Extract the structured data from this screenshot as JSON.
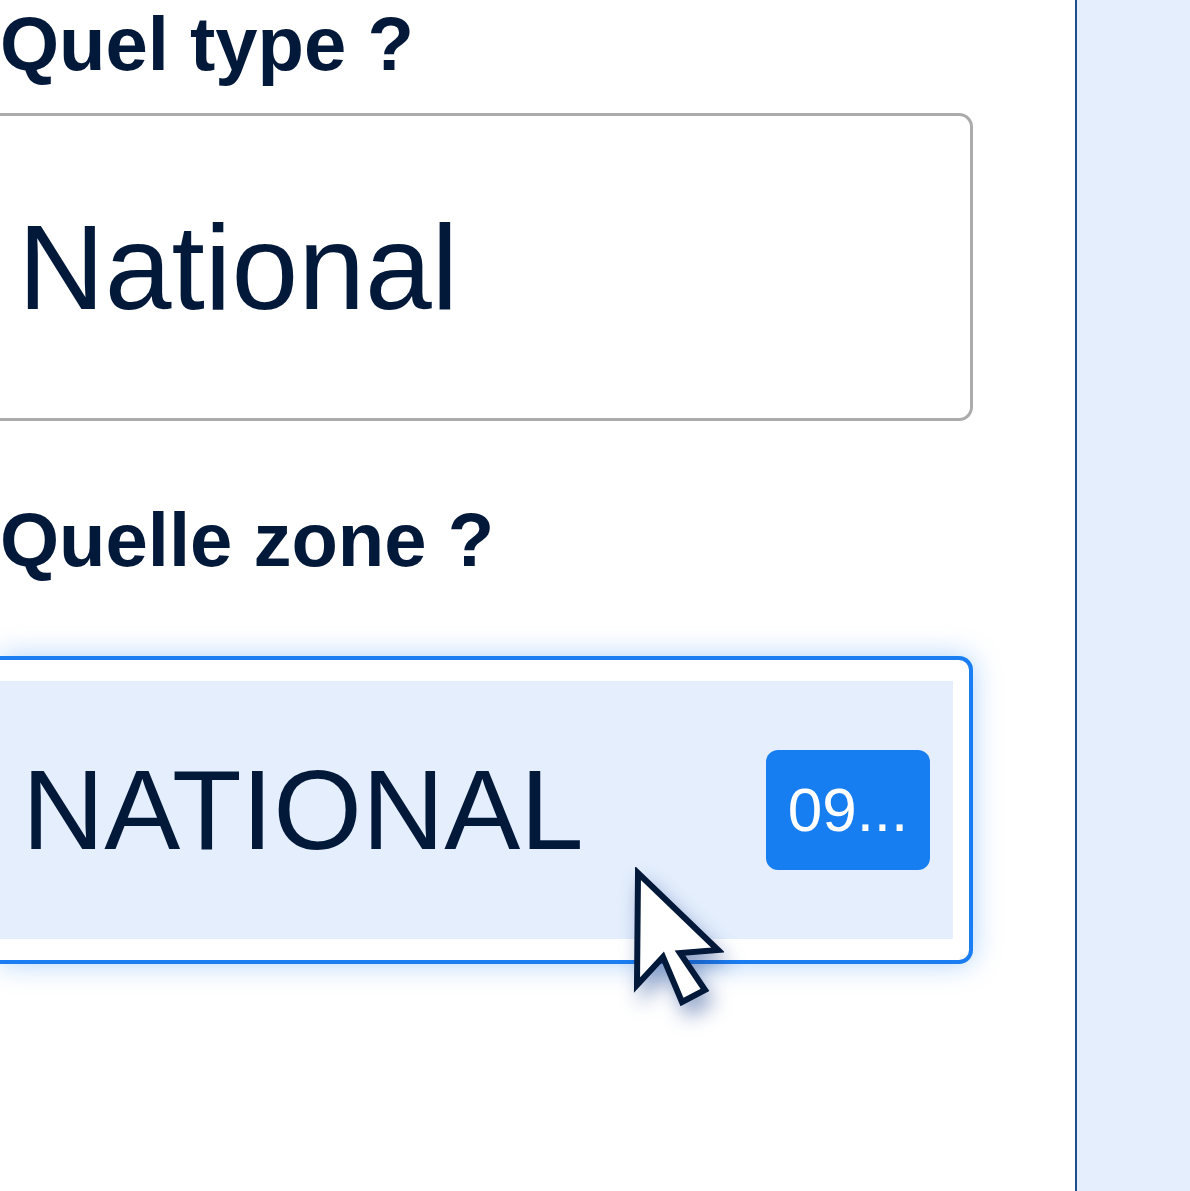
{
  "form": {
    "questions": [
      {
        "label": "Quel type ?",
        "field": {
          "kind": "select",
          "focused": false,
          "value": "National"
        }
      },
      {
        "label": "Quelle zone ?",
        "field": {
          "kind": "listbox",
          "focused": true,
          "options": [
            {
              "label": "NATIONAL",
              "code": "09...",
              "selected": true
            }
          ]
        }
      }
    ]
  }
}
